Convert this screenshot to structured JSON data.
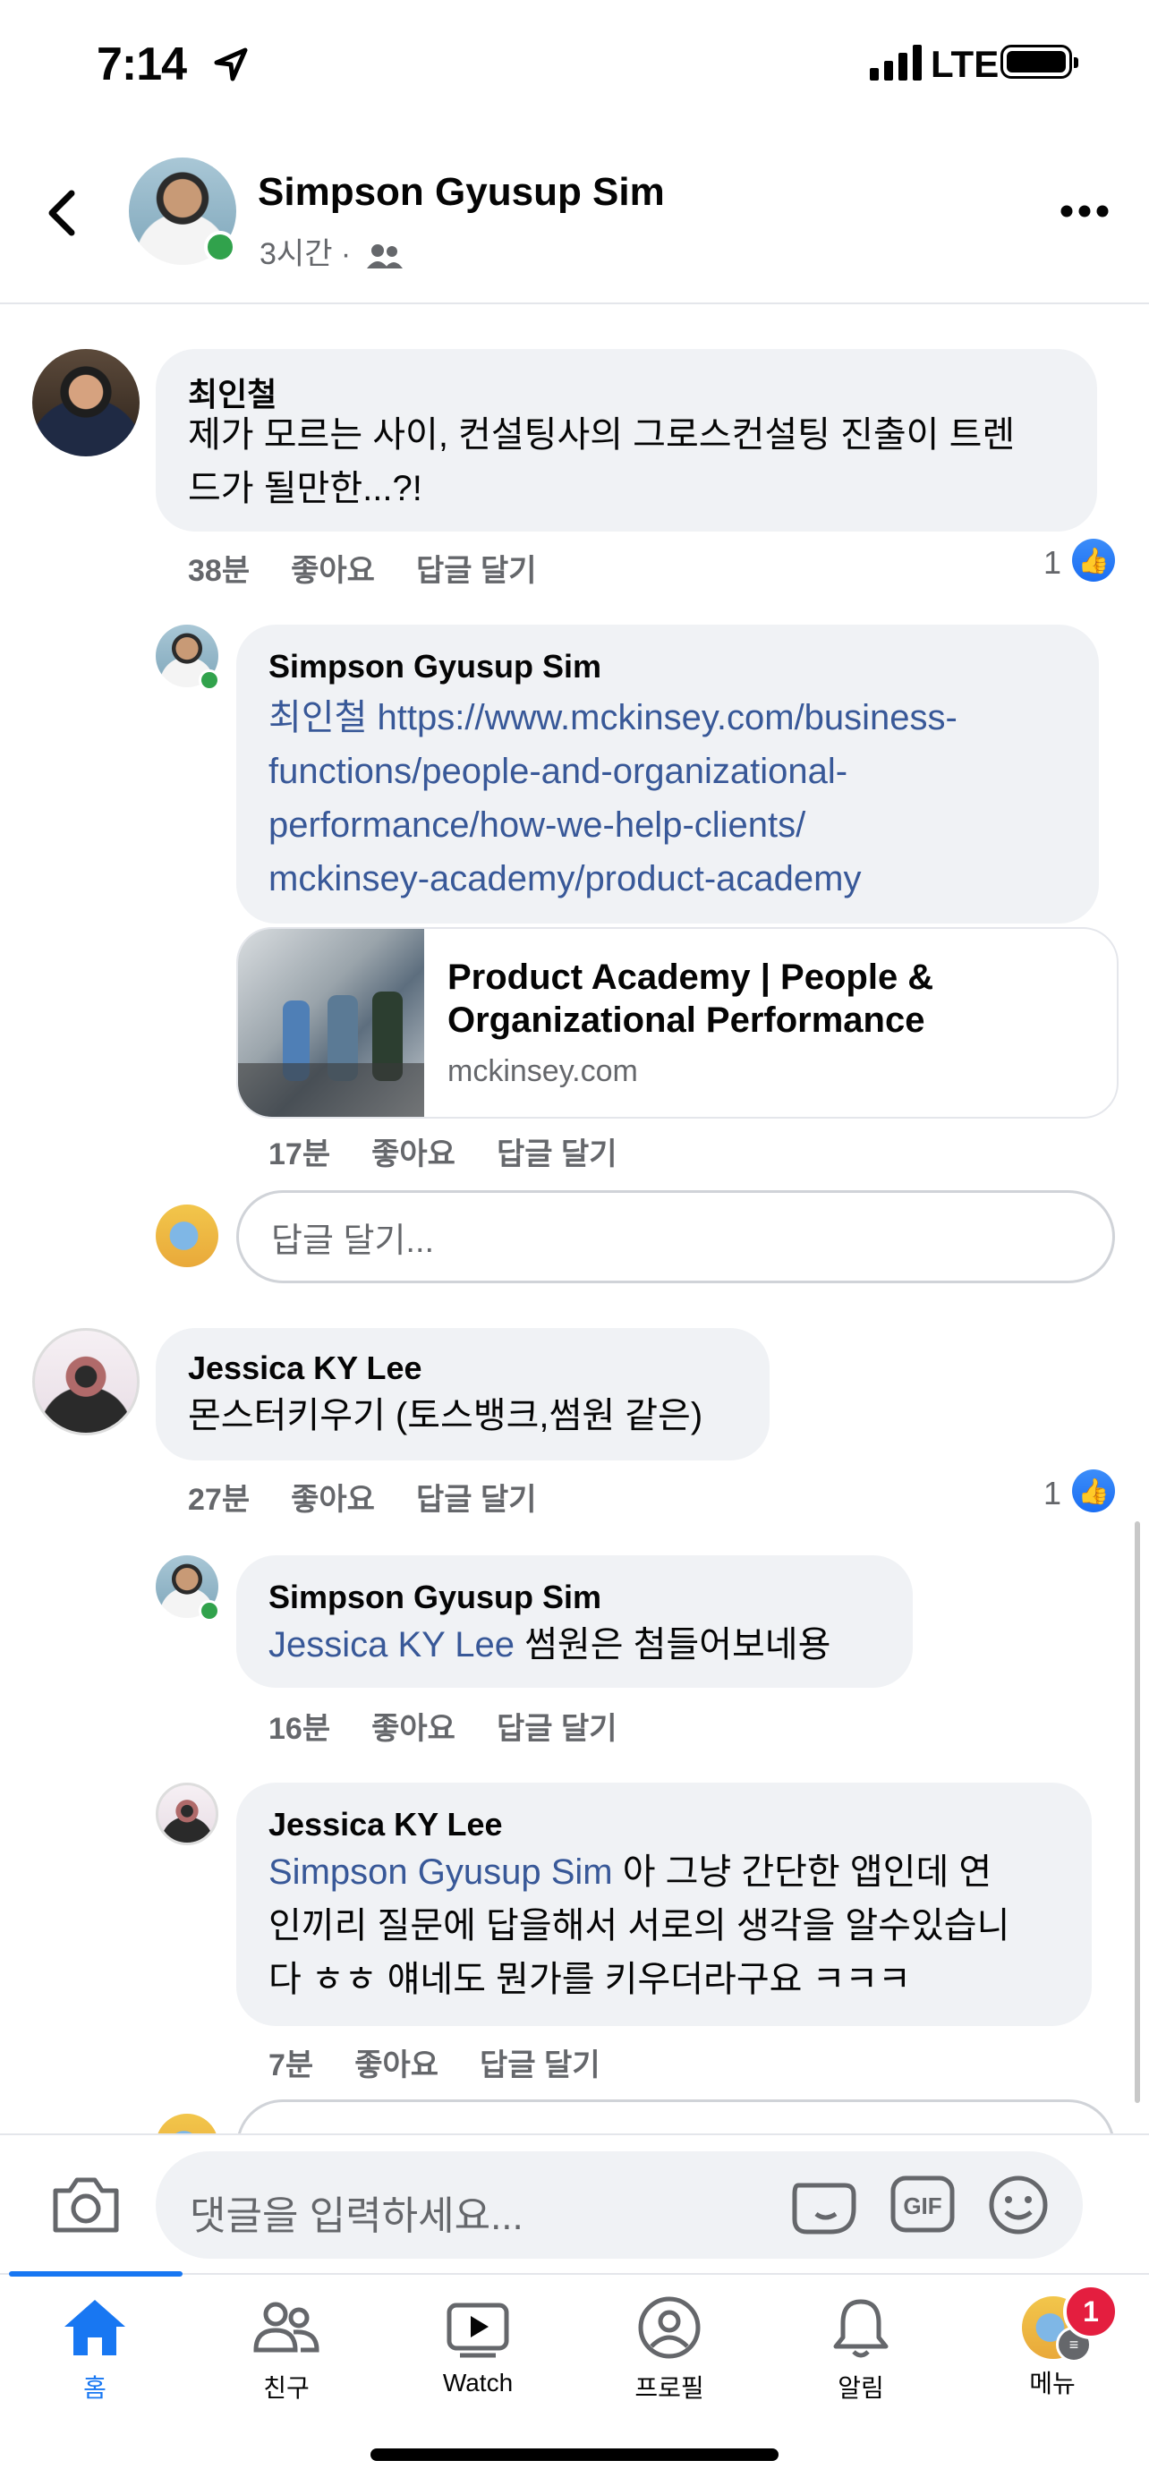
{
  "status": {
    "time": "7:14",
    "network": "LTE"
  },
  "header": {
    "name": "Simpson Gyusup Sim",
    "subtitle": "3시간 ·"
  },
  "comments": [
    {
      "author": "최인철",
      "text": "제가 모르는 사이, 컨설팅사의 그로스컨설팅 진출이 트렌드가 될만한...?!",
      "line1": "제가 모르는 사이, 컨설팅사의 그로스컨설팅 진출이 트렌",
      "line2": "드가 될만한...?!",
      "time": "38분",
      "like": "좋아요",
      "reply": "답글 달기",
      "like_count": "1"
    },
    {
      "author": "Simpson Gyusup Sim",
      "mention": "최인철",
      "link_lines": [
        "https://www.mckinsey.com/business-",
        "functions/people-and-organizational-",
        "performance/how-we-help-clients/",
        "mckinsey-academy/product-academy"
      ],
      "card_title_1": "Product Academy | People &",
      "card_title_2": "Organizational Performance",
      "card_domain": "mckinsey.com",
      "time": "17분",
      "like": "좋아요",
      "reply": "답글 달기"
    },
    {
      "author": "Jessica KY Lee",
      "text": "몬스터키우기 (토스뱅크,썸원 같은)",
      "time": "27분",
      "like": "좋아요",
      "reply": "답글 달기",
      "like_count": "1"
    },
    {
      "author": "Simpson Gyusup Sim",
      "mention": "Jessica KY Lee",
      "text": " 썸원은 첨들어보네용",
      "time": "16분",
      "like": "좋아요",
      "reply": "답글 달기"
    },
    {
      "author": "Jessica KY Lee",
      "mention": "Simpson Gyusup Sim",
      "line1": " 아 그냥 간단한 앱인데 연",
      "line2": "인끼리 질문에 답을해서 서로의 생각을 알수있습니",
      "line3": "다 ㅎㅎ 얘네도 뭔가를 키우더라구요 ㅋㅋㅋ",
      "time": "7분",
      "like": "좋아요",
      "reply": "답글 달기"
    }
  ],
  "reply_placeholder": "답글 달기...",
  "comment_placeholder": "댓글을 입력하세요...",
  "gif_label": "GIF",
  "tabs": [
    {
      "label": "홈",
      "icon": "home-icon"
    },
    {
      "label": "친구",
      "icon": "friends-icon"
    },
    {
      "label": "Watch",
      "icon": "watch-icon"
    },
    {
      "label": "프로필",
      "icon": "profile-icon"
    },
    {
      "label": "알림",
      "icon": "bell-icon"
    },
    {
      "label": "메뉴",
      "icon": "menu-avatar"
    }
  ],
  "notification_count": "1",
  "accent": "#1877f2"
}
